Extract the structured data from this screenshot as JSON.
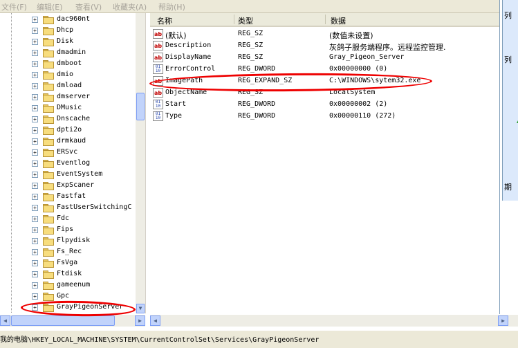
{
  "menu": {
    "items": [
      "文件(F)",
      "编辑(E)",
      "查看(V)",
      "收藏夹(A)",
      "帮助(H)"
    ]
  },
  "tree": {
    "items": [
      {
        "label": "dac960nt"
      },
      {
        "label": "Dhcp"
      },
      {
        "label": "Disk"
      },
      {
        "label": "dmadmin"
      },
      {
        "label": "dmboot"
      },
      {
        "label": "dmio"
      },
      {
        "label": "dmload"
      },
      {
        "label": "dmserver"
      },
      {
        "label": "DMusic"
      },
      {
        "label": "Dnscache"
      },
      {
        "label": "dpti2o"
      },
      {
        "label": "drmkaud"
      },
      {
        "label": "ERSvc"
      },
      {
        "label": "Eventlog"
      },
      {
        "label": "EventSystem"
      },
      {
        "label": "ExpScaner"
      },
      {
        "label": "Fastfat"
      },
      {
        "label": "FastUserSwitchingC"
      },
      {
        "label": "Fdc"
      },
      {
        "label": "Fips"
      },
      {
        "label": "Flpydisk"
      },
      {
        "label": "Fs_Rec"
      },
      {
        "label": "FsVga"
      },
      {
        "label": "Ftdisk"
      },
      {
        "label": "gameenum"
      },
      {
        "label": "Gpc"
      },
      {
        "label": "GrayPigeonServer",
        "selected": true
      }
    ],
    "expander_symbol": "+"
  },
  "list": {
    "columns": {
      "name": "名称",
      "type": "类型",
      "data": "数据"
    },
    "rows": [
      {
        "icon": "ab",
        "name": "(默认)",
        "type": "REG_SZ",
        "data": "(数值未设置)"
      },
      {
        "icon": "ab",
        "name": "Description",
        "type": "REG_SZ",
        "data": "灰鸽子服务端程序。远程监控管理."
      },
      {
        "icon": "ab",
        "name": "DisplayName",
        "type": "REG_SZ",
        "data": "Gray_Pigeon_Server"
      },
      {
        "icon": "dw",
        "name": "ErrorControl",
        "type": "REG_DWORD",
        "data": "0x00000000 (0)"
      },
      {
        "icon": "ab",
        "name": "ImagePath",
        "type": "REG_EXPAND_SZ",
        "data": "C:\\WINDOWS\\sytem32.exe"
      },
      {
        "icon": "ab",
        "name": "ObjectName",
        "type": "REG_SZ",
        "data": "LocalSystem"
      },
      {
        "icon": "dw",
        "name": "Start",
        "type": "REG_DWORD",
        "data": "0x00000002 (2)"
      },
      {
        "icon": "dw",
        "name": "Type",
        "type": "REG_DWORD",
        "data": "0x00000110 (272)"
      }
    ]
  },
  "edge": {
    "chars": [
      "列",
      "列",
      "期"
    ]
  },
  "status": {
    "path": "我的电脑\\HKEY_LOCAL_MACHINE\\SYSTEM\\CurrentControlSet\\Services\\GrayPigeonServer"
  },
  "colors": {
    "annotation": "#ee0000",
    "bar_bg": "#ece9d8"
  }
}
